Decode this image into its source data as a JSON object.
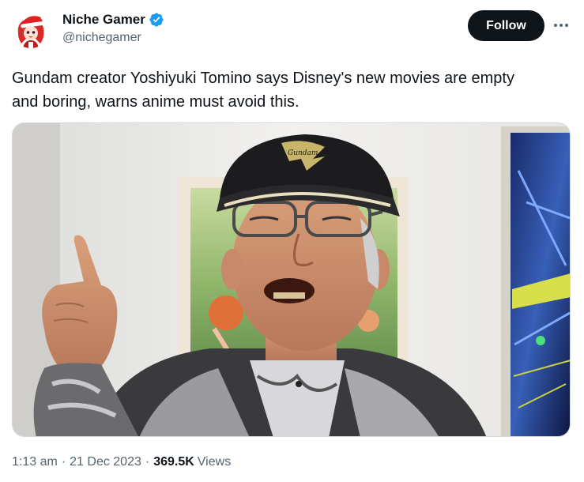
{
  "account": {
    "display_name": "Niche Gamer",
    "handle": "@nichegamer",
    "verified": true,
    "verified_color": "#1d9bf0",
    "avatar_icon": "anime-character-santa-hat-avatar"
  },
  "actions": {
    "follow_label": "Follow",
    "more_icon": "more-horizontal-icon"
  },
  "tweet": {
    "text_line1": "Gundam creator Yoshiyuki Tomino says Disney's new movies are empty",
    "text_line2": "and boring, warns anime must avoid this."
  },
  "media": {
    "cap_text": "Gundam"
  },
  "meta": {
    "time": "1:13 am",
    "date": "21 Dec 2023",
    "separator": "·",
    "views_count": "369.5K",
    "views_label": "Views"
  },
  "colors": {
    "follow_bg": "#0f1419",
    "secondary_text": "#536471",
    "border": "#cfd9de"
  }
}
